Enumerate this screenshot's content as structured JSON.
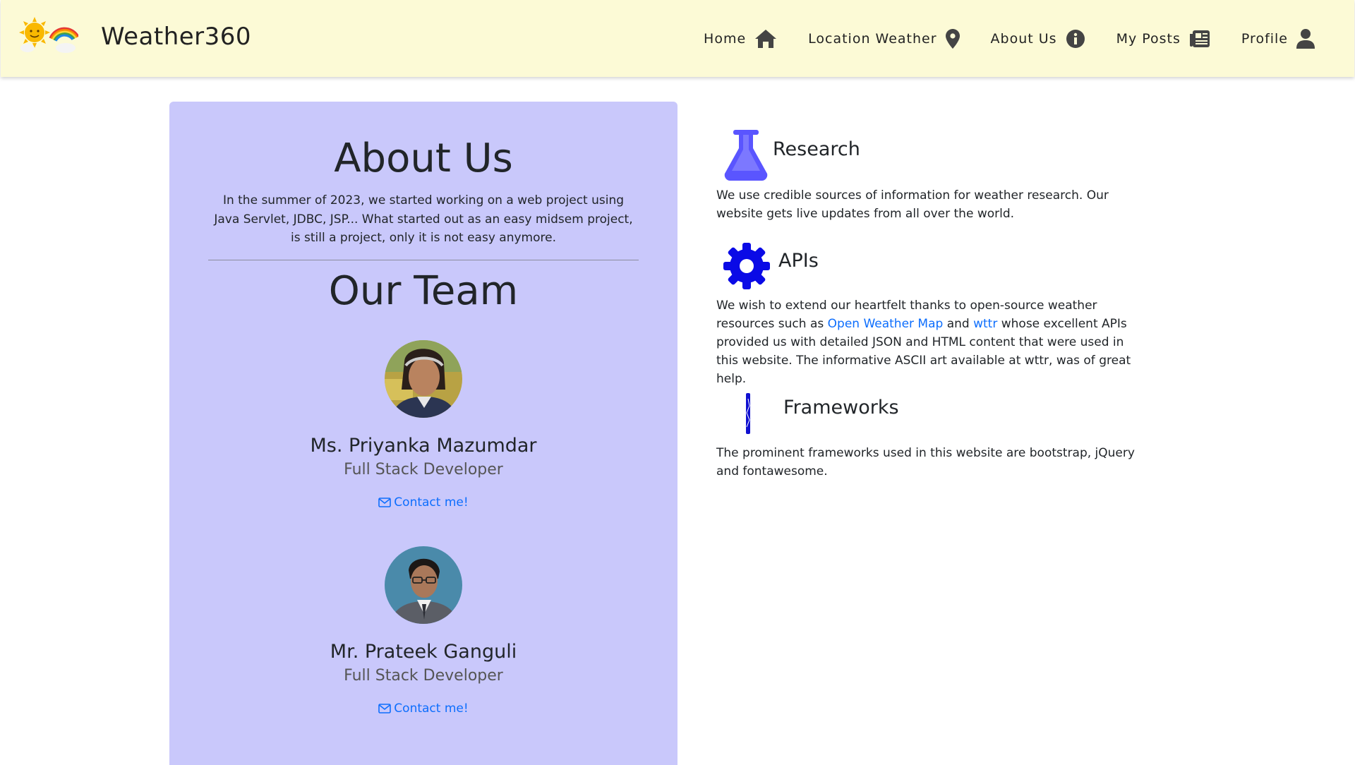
{
  "brand": {
    "name": "Weather360"
  },
  "nav": {
    "home": "Home",
    "location": "Location Weather",
    "about": "About Us",
    "posts": "My Posts",
    "profile": "Profile"
  },
  "about": {
    "title": "About Us",
    "intro": "In the summer of 2023, we started working on a web project using Java Servlet, JDBC, JSP... What started out as an easy midsem project, is still a project, only it is not easy anymore.",
    "team_title": "Our Team",
    "members": [
      {
        "name": "Ms. Priyanka Mazumdar",
        "role": "Full Stack Developer",
        "contact": "Contact me!"
      },
      {
        "name": "Mr. Prateek Ganguli",
        "role": "Full Stack Developer",
        "contact": "Contact me!"
      }
    ]
  },
  "features": {
    "research": {
      "title": "Research",
      "text": "We use credible sources of information for weather research. Our website gets live updates from all over the world."
    },
    "apis": {
      "title": "APIs",
      "text_1": "We wish to extend our heartfelt thanks to open-source weather resources such as",
      "link_1": "Open Weather Map",
      "text_2": "and",
      "link_2": "wttr",
      "text_3": "whose excellent APIs provided us with detailed JSON and HTML content that were used in this website. The informative ASCII art available at wttr, was of great help."
    },
    "frameworks": {
      "title": "Frameworks",
      "text": "The prominent frameworks used in this website are bootstrap, jQuery and fontawesome."
    }
  },
  "colors": {
    "navbar_bg": "#fcfad6",
    "card_bg": "#c9c8fb",
    "link": "#0d6efd",
    "research_icon": "#5a55ff",
    "apis_icon": "#0a0ae6",
    "frameworks_icon": "#1010d0"
  }
}
